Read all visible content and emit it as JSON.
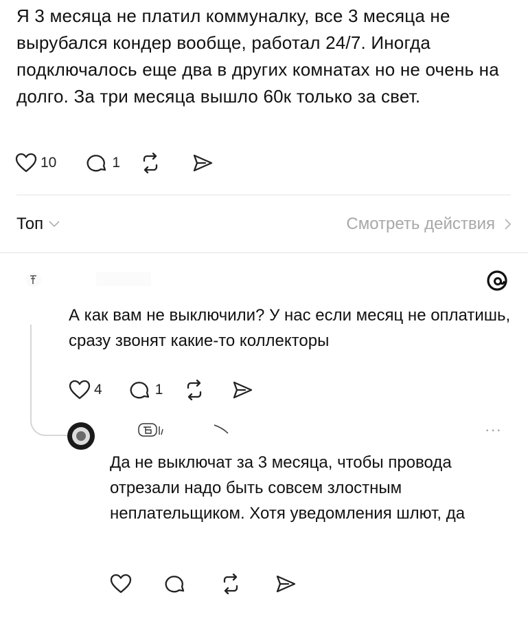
{
  "post": {
    "text": "Я 3 месяца не платил коммуналку, все 3 месяца не вырубался кондер вообще, работал 24/7. Иногда подключалось еще два в других комнатах но не очень на долго. За три месяца вышло 60к только за свет.",
    "likes": "10",
    "replies": "1"
  },
  "sort": {
    "label": "Топ",
    "view_activity": "Смотреть действия"
  },
  "reply1": {
    "text": "А как вам не выключили? У нас если месяц не оплатишь, сразу звонят какие-то коллекторы",
    "likes": "4",
    "replies": "1",
    "badge_icon": "threads-logo-icon"
  },
  "reply2": {
    "text": "Да не выключат за 3 месяца, чтобы провода отрезали надо быть совсем злостным неплательщиком. Хотя уведомления шлют, да",
    "more": "···"
  },
  "icons": [
    "heart-icon",
    "comment-icon",
    "repost-icon",
    "share-icon",
    "chevron-down-icon",
    "chevron-right-icon",
    "more-icon",
    "threads-logo-icon"
  ],
  "colors": {
    "text": "#111111",
    "muted": "#a8a8a8",
    "divider": "#e3e3e3",
    "thread_line": "#d6d6d6"
  }
}
